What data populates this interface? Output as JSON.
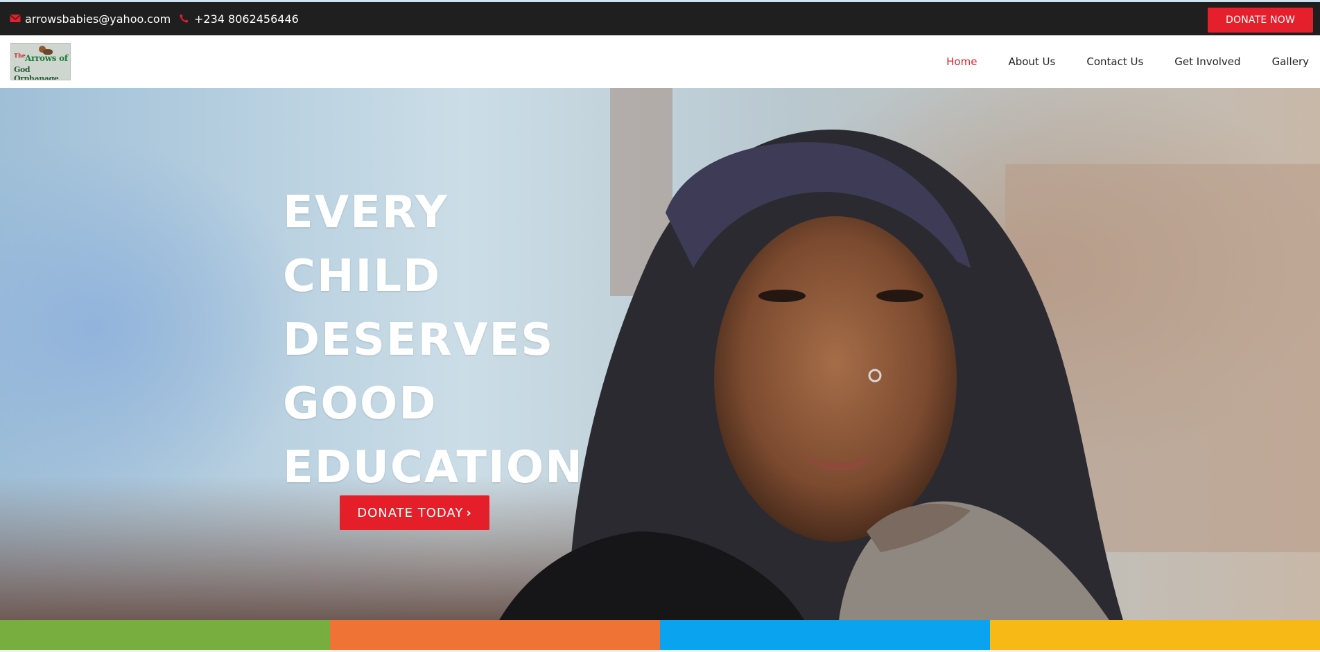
{
  "topbar": {
    "email": "arrowsbabies@yahoo.com",
    "phone": "+234 8062456446",
    "donate_label": "DONATE NOW",
    "email_icon": "envelope-icon",
    "phone_icon": "phone-icon"
  },
  "logo": {
    "line_the": "The",
    "line1": "Arrows of",
    "line2": "God Orphanage"
  },
  "nav": {
    "items": [
      {
        "label": "Home",
        "active": true
      },
      {
        "label": "About Us"
      },
      {
        "label": "Contact Us"
      },
      {
        "label": "Get Involved"
      },
      {
        "label": "Gallery"
      }
    ]
  },
  "hero": {
    "headline_lines": [
      "EVERY CHILD",
      "DESERVES",
      "GOOD",
      "EDUCATION"
    ],
    "cta_label": "DONATE TODAY",
    "cta_icon": "chevron-right-icon"
  },
  "colors": {
    "accent": "#e61f2c",
    "topbar": "#1f1f20",
    "strip_green": "#78ae3f",
    "strip_orange": "#ee7334",
    "strip_blue": "#0aa3ef",
    "strip_yellow": "#f6b915"
  }
}
